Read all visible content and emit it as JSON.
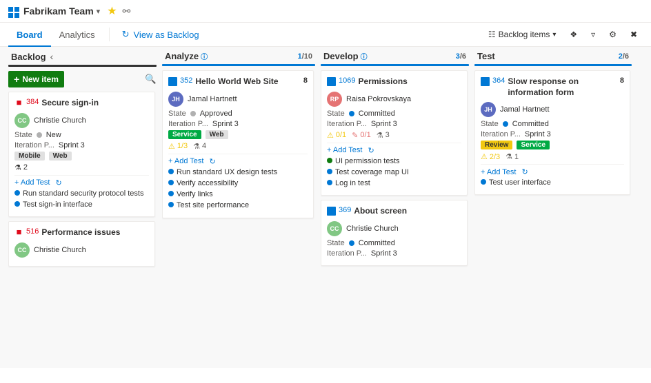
{
  "topBar": {
    "teamName": "Fabrikam Team",
    "chevronLabel": "▾",
    "starLabel": "★",
    "peopleLabel": "⚇"
  },
  "navBar": {
    "tabs": [
      {
        "id": "board",
        "label": "Board",
        "active": true
      },
      {
        "id": "analytics",
        "label": "Analytics",
        "active": false
      }
    ],
    "viewBacklog": "View as Backlog",
    "backlogItems": "Backlog items",
    "filterIcon": "⚲",
    "settingsIcon": "⚙",
    "expandIcon": "⤢"
  },
  "board": {
    "columns": [
      {
        "id": "backlog",
        "title": "Backlog",
        "count": "",
        "accentColor": "#333",
        "newItemLabel": "+ New item",
        "cards": [
          {
            "id": "384",
            "title": "Secure sign-in",
            "type": "bug",
            "person": "Christie Church",
            "avatarClass": "avatar-cc",
            "avatarInitials": "CC",
            "state": "New",
            "stateDot": "dot-new",
            "iteration": "Iteration P...",
            "sprint": "Sprint 3",
            "tags": [
              "Mobile",
              "Web"
            ],
            "metrics": [
              {
                "type": "beaker",
                "value": "2"
              }
            ],
            "actions": [
              "Add Test",
              "↪"
            ],
            "tasks": [
              {
                "text": "Run standard security protocol tests",
                "dot": "blue"
              },
              {
                "text": "Test sign-in interface",
                "dot": "blue"
              }
            ]
          },
          {
            "id": "516",
            "title": "Performance issues",
            "type": "bug",
            "person": "Christie Church",
            "avatarClass": "avatar-cc",
            "avatarInitials": "CC",
            "state": "",
            "stateDot": "",
            "iteration": "",
            "sprint": "",
            "tags": [],
            "metrics": [],
            "actions": [],
            "tasks": []
          }
        ]
      },
      {
        "id": "analyze",
        "title": "Analyze",
        "countCurrent": "1",
        "countTotal": "10",
        "accentColor": "#0078d4",
        "cards": [
          {
            "id": "352",
            "title": "Hello World Web Site",
            "type": "story",
            "person": "Jamal Hartnett",
            "avatarClass": "avatar-jh",
            "avatarInitials": "JH",
            "state": "Approved",
            "stateDot": "dot-approved",
            "iteration": "Iteration P...",
            "sprint": "Sprint 3",
            "tags": [
              "Service",
              "Web"
            ],
            "metrics": [
              {
                "type": "warning",
                "value": "1/3"
              },
              {
                "type": "beaker",
                "value": "4"
              }
            ],
            "numberBadge": "8",
            "actions": [
              "Add Test",
              "↪"
            ],
            "tasks": [
              {
                "text": "Run standard UX design tests",
                "dot": "blue"
              },
              {
                "text": "Verify accessibility",
                "dot": "blue"
              },
              {
                "text": "Verify links",
                "dot": "blue"
              },
              {
                "text": "Test site performance",
                "dot": "blue"
              }
            ]
          }
        ]
      },
      {
        "id": "develop",
        "title": "Develop",
        "countCurrent": "3",
        "countTotal": "6",
        "accentColor": "#0078d4",
        "cards": [
          {
            "id": "1069",
            "title": "Permissions",
            "type": "story",
            "person": "Raisa Pokrovskaya",
            "avatarClass": "avatar-rp",
            "avatarInitials": "RP",
            "state": "Committed",
            "stateDot": "dot-committed",
            "iteration": "Iteration P...",
            "sprint": "Sprint 3",
            "tags": [],
            "metrics": [
              {
                "type": "warning",
                "value": "0/1"
              },
              {
                "type": "pencil",
                "value": "0/1"
              },
              {
                "type": "beaker",
                "value": "3"
              }
            ],
            "actions": [
              "Add Test",
              "↪"
            ],
            "tasks": [
              {
                "text": "UI permission tests",
                "dot": "green"
              },
              {
                "text": "Test coverage map UI",
                "dot": "blue"
              },
              {
                "text": "Log in test",
                "dot": "blue"
              }
            ]
          },
          {
            "id": "369",
            "title": "About screen",
            "type": "story",
            "person": "Christie Church",
            "avatarClass": "avatar-cc",
            "avatarInitials": "CC",
            "state": "Committed",
            "stateDot": "dot-committed",
            "iteration": "Iteration P...",
            "sprint": "Sprint 3",
            "tags": [],
            "metrics": [],
            "actions": [],
            "tasks": []
          }
        ]
      },
      {
        "id": "test",
        "title": "Test",
        "countCurrent": "2",
        "countTotal": "6",
        "accentColor": "#0078d4",
        "cards": [
          {
            "id": "364",
            "title": "Slow response on information form",
            "type": "story",
            "person": "Jamal Hartnett",
            "avatarClass": "avatar-jh",
            "avatarInitials": "JH",
            "state": "Committed",
            "stateDot": "dot-committed",
            "iteration": "Iteration P...",
            "sprint": "Sprint 3",
            "tags": [
              "Review",
              "Service"
            ],
            "metrics": [
              {
                "type": "warning",
                "value": "2/3"
              },
              {
                "type": "beaker",
                "value": "1"
              }
            ],
            "numberBadge": "8",
            "actions": [
              "Add Test",
              "↪"
            ],
            "tasks": [
              {
                "text": "Test user interface",
                "dot": "blue"
              }
            ]
          }
        ]
      }
    ]
  },
  "labels": {
    "state": "State",
    "iterationPath": "Iteration P...",
    "sprintValue": "Sprint 3",
    "addTest": "+ Add Test",
    "newItem": "New item"
  }
}
